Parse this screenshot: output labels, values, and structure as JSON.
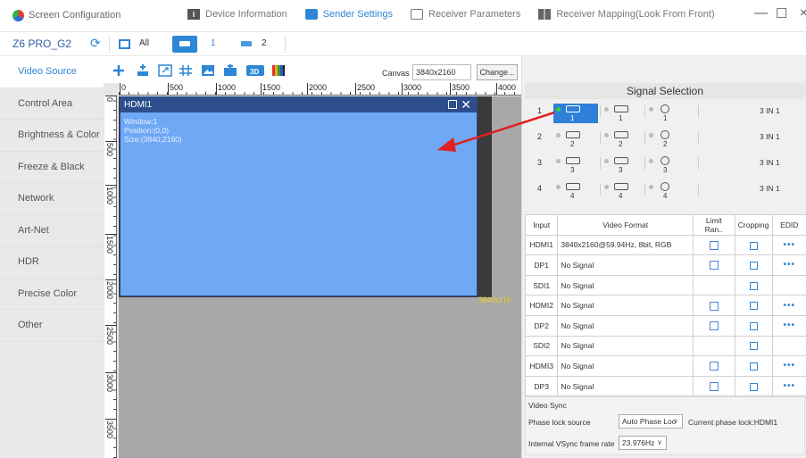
{
  "app": {
    "title": "Screen Configuration"
  },
  "topnav": {
    "tabs": [
      {
        "label": "Device Information",
        "icon": "info-icon"
      },
      {
        "label": "Sender Settings",
        "icon": "sender-icon",
        "active": true
      },
      {
        "label": "Receiver Parameters",
        "icon": "receiver-icon"
      },
      {
        "label": "Receiver Mapping(Look From Front)",
        "icon": "mapping-icon"
      }
    ],
    "window_controls": {
      "minimize": "—",
      "maximize": "☐",
      "close": "×"
    }
  },
  "subbar": {
    "device": "Z6 PRO_G2",
    "all_label": "All",
    "sender1_label": "1",
    "sender2_label": "2"
  },
  "sidebar": {
    "items": [
      {
        "label": "Video Source",
        "active": true
      },
      {
        "label": "Control Area"
      },
      {
        "label": "Brightness & Color"
      },
      {
        "label": "Freeze & Black"
      },
      {
        "label": "Network"
      },
      {
        "label": "Art-Net"
      },
      {
        "label": "HDR"
      },
      {
        "label": "Precise Color"
      },
      {
        "label": "Other"
      }
    ]
  },
  "toolbar": {
    "canvas_label": "Canvas",
    "canvas_value": "3840x2160",
    "change_label": "Change..."
  },
  "ruler": {
    "x_ticks": [
      "0",
      "500",
      "1000",
      "1500",
      "2000",
      "2500",
      "3000",
      "3500",
      "4000"
    ],
    "y_ticks": [
      "0",
      "500",
      "1000",
      "1500",
      "2000",
      "2500",
      "3000",
      "3500"
    ]
  },
  "window": {
    "name": "HDMI1",
    "info": [
      "Window:1",
      "Position:(0,0)",
      "Size:(3840,2160)"
    ],
    "resolution_label": "3840x216"
  },
  "signal_selection": {
    "title": "Signal Selection",
    "rows": [
      {
        "num": "1",
        "mode": "3 IN 1",
        "ports": [
          "1",
          "1",
          "1"
        ],
        "selected": 0,
        "active_dot": true
      },
      {
        "num": "2",
        "mode": "3 IN 1",
        "ports": [
          "2",
          "2",
          "2"
        ]
      },
      {
        "num": "3",
        "mode": "3 IN 1",
        "ports": [
          "3",
          "3",
          "3"
        ]
      },
      {
        "num": "4",
        "mode": "3 IN 1",
        "ports": [
          "4",
          "4",
          "4"
        ]
      }
    ]
  },
  "input_table": {
    "headers": [
      "Input",
      "Video Format",
      "Limit Ran..",
      "Cropping",
      "EDID"
    ],
    "rows": [
      {
        "input": "HDMI1",
        "format": "3840x2160@59.94Hz, 8bit, RGB",
        "limit": true,
        "edid": true
      },
      {
        "input": "DP1",
        "format": "No Signal",
        "limit": true,
        "edid": true
      },
      {
        "input": "SDI1",
        "format": "No Signal",
        "limit": false,
        "edid": false
      },
      {
        "input": "HDMI2",
        "format": "No Signal",
        "limit": true,
        "edid": true
      },
      {
        "input": "DP2",
        "format": "No Signal",
        "limit": true,
        "edid": true
      },
      {
        "input": "SDI2",
        "format": "No Signal",
        "limit": false,
        "edid": false
      },
      {
        "input": "HDMI3",
        "format": "No Signal",
        "limit": true,
        "edid": true
      },
      {
        "input": "DP3",
        "format": "No Signal",
        "limit": true,
        "edid": true
      }
    ],
    "more_glyph": "•••"
  },
  "video_sync": {
    "title": "Video Sync",
    "phase_lock_label": "Phase lock source",
    "phase_lock_value": "Auto Phase Loc",
    "current_phase_lock": "Current phase lock:HDMI1",
    "vsync_label": "Internal VSync frame rate",
    "vsync_value": "23.976Hz"
  },
  "colors": {
    "accent": "#2d87d6",
    "window_fill": "#6fa8f5",
    "window_head": "#2c4f8c",
    "arrow": "#e02020"
  }
}
